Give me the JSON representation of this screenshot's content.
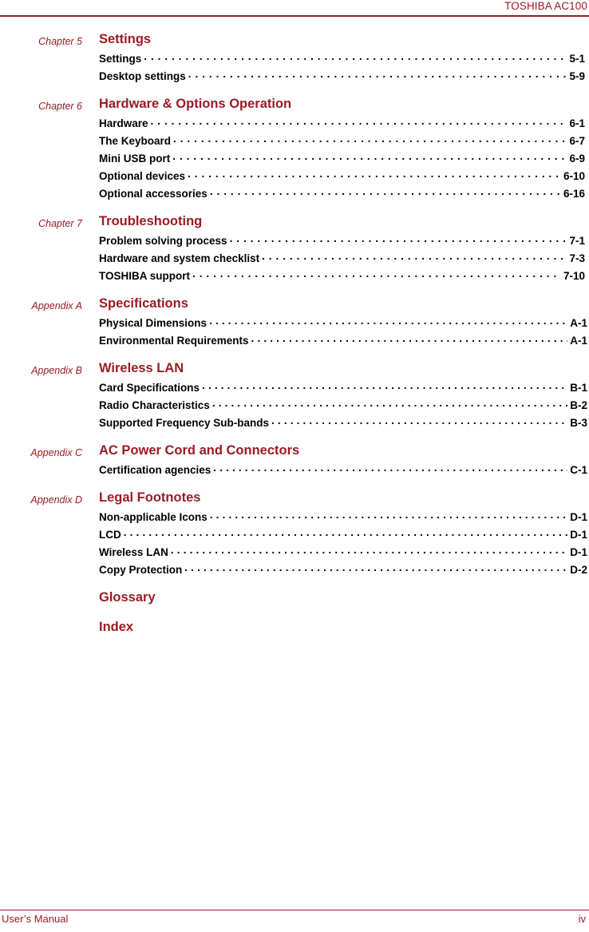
{
  "header": {
    "title": "TOSHIBA AC100"
  },
  "footer": {
    "left": "User’s Manual",
    "page": "iv"
  },
  "colors": {
    "accent": "#9b1b24",
    "text": "#000000",
    "background": "#ffffff"
  },
  "toc": {
    "groups": [
      {
        "label": "Chapter 5",
        "title": "Settings",
        "entries": [
          {
            "label": "Settings",
            "page": "5-1"
          },
          {
            "label": "Desktop settings",
            "page": "5-9"
          }
        ]
      },
      {
        "label": "Chapter 6",
        "title": "Hardware & Options Operation",
        "entries": [
          {
            "label": "Hardware",
            "page": "6-1"
          },
          {
            "label": "The Keyboard",
            "page": "6-7"
          },
          {
            "label": "Mini USB port",
            "page": "6-9"
          },
          {
            "label": "Optional devices",
            "page": "6-10"
          },
          {
            "label": "Optional accessories",
            "page": "6-16"
          }
        ]
      },
      {
        "label": "Chapter 7",
        "title": "Troubleshooting",
        "entries": [
          {
            "label": "Problem solving process",
            "page": "7-1"
          },
          {
            "label": "Hardware and system checklist",
            "page": "7-3"
          },
          {
            "label": "TOSHIBA support",
            "page": "7-10"
          }
        ]
      },
      {
        "label": "Appendix A",
        "title": "Specifications",
        "entries": [
          {
            "label": "Physical Dimensions",
            "page": "A-1"
          },
          {
            "label": "Environmental Requirements",
            "page": "A-1"
          }
        ]
      },
      {
        "label": "Appendix B",
        "title": "Wireless LAN",
        "entries": [
          {
            "label": "Card Specifications",
            "page": "B-1"
          },
          {
            "label": "Radio Characteristics",
            "page": "B-2"
          },
          {
            "label": "Supported Frequency Sub-bands",
            "page": "B-3"
          }
        ]
      },
      {
        "label": "Appendix C",
        "title": "AC Power Cord and Connectors",
        "entries": [
          {
            "label": "Certification agencies",
            "page": "C-1"
          }
        ]
      },
      {
        "label": "Appendix D",
        "title": "Legal Footnotes",
        "entries": [
          {
            "label": "Non-applicable Icons",
            "page": "D-1"
          },
          {
            "label": "LCD",
            "page": "D-1"
          },
          {
            "label": "Wireless LAN",
            "page": "D-1"
          },
          {
            "label": "Copy Protection",
            "page": "D-2"
          }
        ]
      }
    ],
    "standalone": [
      {
        "title": "Glossary"
      },
      {
        "title": "Index"
      }
    ]
  }
}
